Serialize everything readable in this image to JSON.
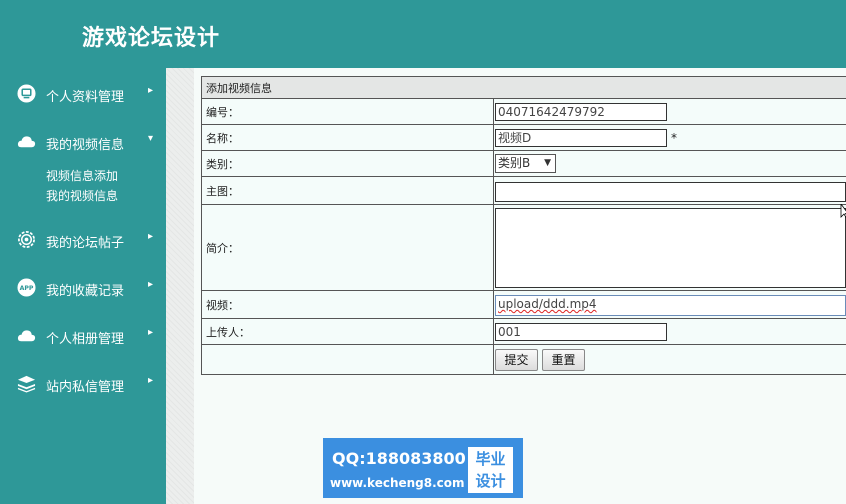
{
  "header": {
    "title": "游戏论坛设计"
  },
  "sidebar": {
    "items": [
      {
        "label": "个人资料管理",
        "icon": "monitor-icon",
        "arrow": "▸"
      },
      {
        "label": "我的视频信息",
        "icon": "cloud-icon",
        "arrow": "▾",
        "subitems": [
          {
            "label": "视频信息添加"
          },
          {
            "label": "我的视频信息"
          }
        ]
      },
      {
        "label": "我的论坛帖子",
        "icon": "gear-icon",
        "arrow": "▸"
      },
      {
        "label": "我的收藏记录",
        "icon": "app-icon",
        "icon_text": "APP",
        "arrow": "▸"
      },
      {
        "label": "个人相册管理",
        "icon": "cloud-icon",
        "arrow": "▸"
      },
      {
        "label": "站内私信管理",
        "icon": "stack-icon",
        "arrow": "▸"
      }
    ]
  },
  "form": {
    "caption": "添加视频信息",
    "fields": {
      "id": {
        "label": "编号：",
        "value": "04071642479792"
      },
      "name": {
        "label": "名称：",
        "value": "视频D",
        "required": "*"
      },
      "category": {
        "label": "类别：",
        "selected": "类别B",
        "arrow": "▼"
      },
      "image": {
        "label": "主图：",
        "value": ""
      },
      "intro": {
        "label": "简介：",
        "value": ""
      },
      "video": {
        "label": "视频：",
        "value": "upload/ddd.mp4"
      },
      "uploader": {
        "label": "上传人：",
        "value": "001"
      }
    },
    "buttons": {
      "submit": "提交",
      "reset": "重置"
    }
  },
  "watermark": {
    "qq": "QQ:188083800",
    "url": "www.kecheng8.com",
    "line1": "毕业",
    "line2": "设计"
  },
  "colors": {
    "theme": "#2e9898",
    "watermark": "#3b8fe0"
  }
}
